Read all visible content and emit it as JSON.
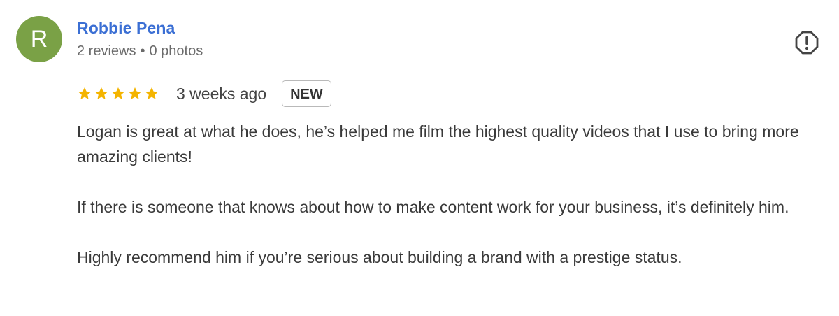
{
  "review": {
    "avatar_letter": "R",
    "avatar_color": "#7aa146",
    "author_name": "Robbie Pena",
    "reviews_count": "2 reviews",
    "separator": "•",
    "photos_count": "0 photos",
    "rating": 5,
    "rating_max": 5,
    "star_color": "#f4b400",
    "time_ago": "3 weeks ago",
    "badge": "NEW",
    "paragraphs": [
      "Logan is great at what he does, he’s helped me film the highest quality videos that I use to bring more amazing clients!",
      "If there is someone that knows about how to make content work for your business, it’s definitely him.",
      "Highly recommend him if you’re serious about building a brand with a prestige status."
    ],
    "flag_icon": "report-flag-icon"
  }
}
